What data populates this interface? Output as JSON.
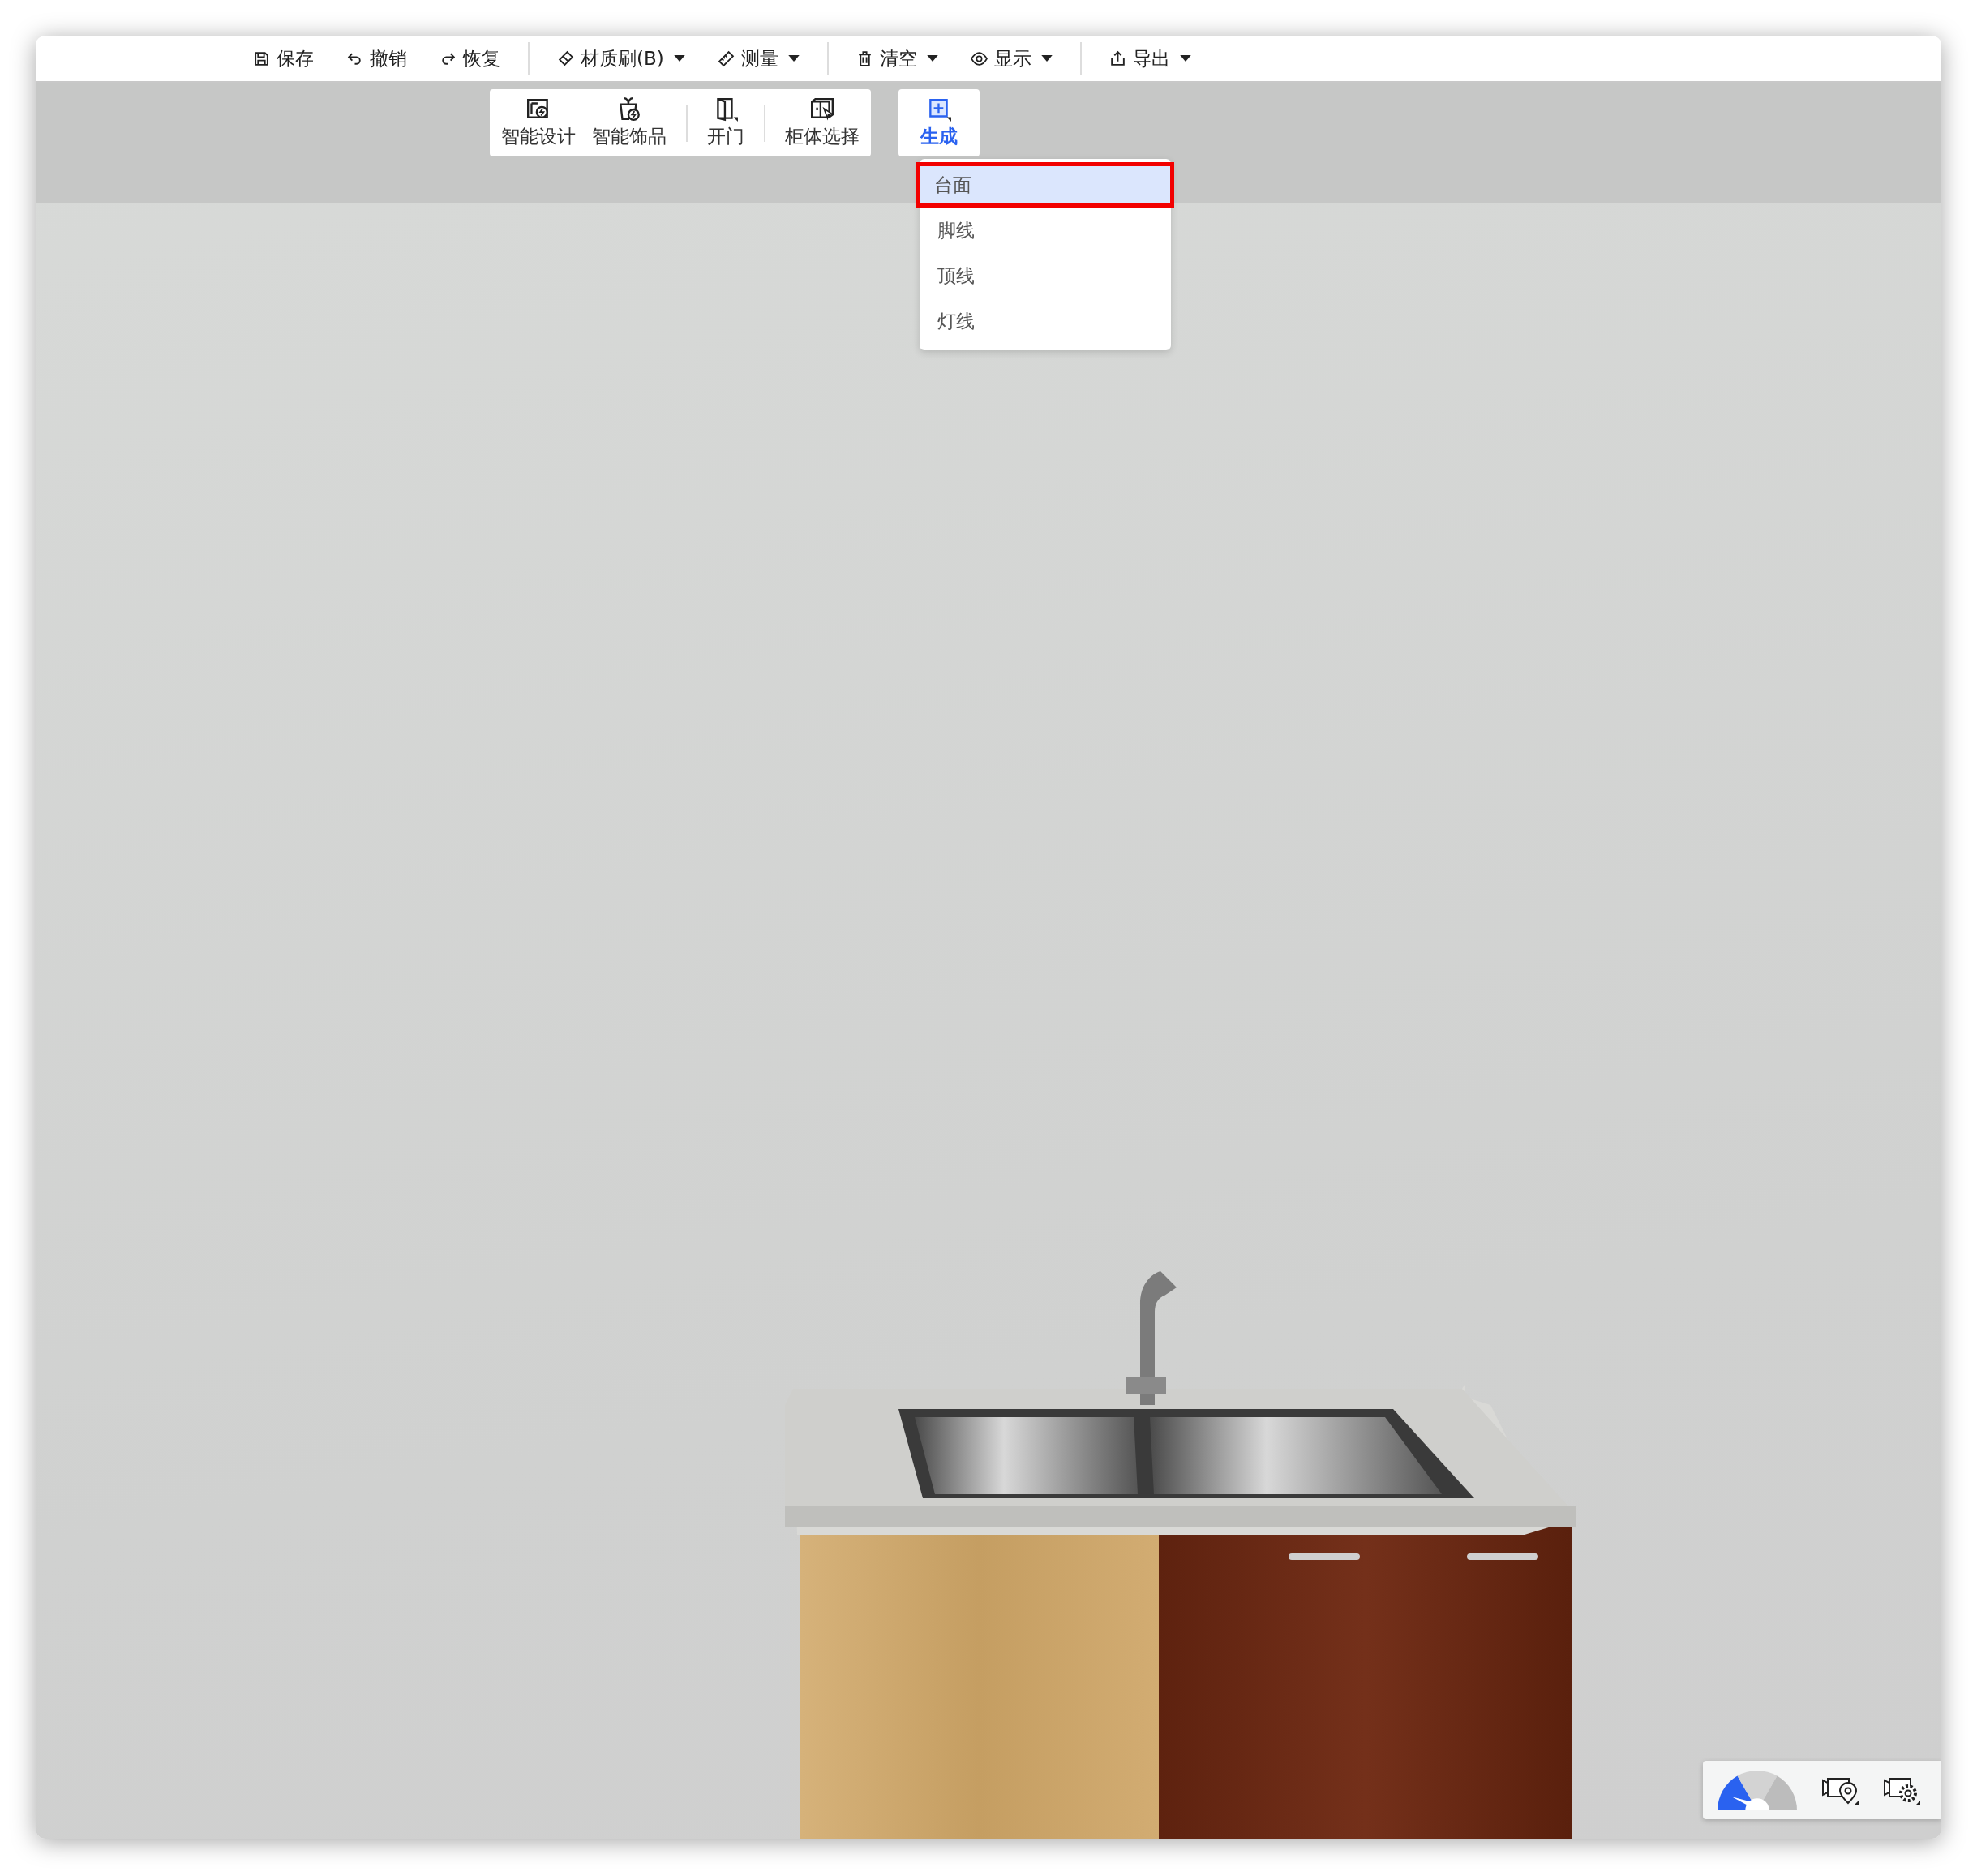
{
  "toolbar": {
    "groups": [
      [
        {
          "label": "保存",
          "dropdown": false
        },
        {
          "label": "撤销",
          "dropdown": false
        },
        {
          "label": "恢复",
          "dropdown": false
        }
      ],
      [
        {
          "label": "材质刷(B)",
          "dropdown": true
        },
        {
          "label": "测量",
          "dropdown": true
        }
      ],
      [
        {
          "label": "清空",
          "dropdown": true
        },
        {
          "label": "显示",
          "dropdown": true
        }
      ],
      [
        {
          "label": "导出",
          "dropdown": true
        }
      ]
    ]
  },
  "tool_panel": {
    "groups": [
      [
        {
          "label": "智能设计"
        },
        {
          "label": "智能饰品"
        }
      ],
      [
        {
          "label": "开门"
        }
      ],
      [
        {
          "label": "柜体选择"
        }
      ]
    ]
  },
  "generate_button": {
    "label": "生成",
    "active": true
  },
  "generate_menu": [
    {
      "label": "台面",
      "selected": true
    },
    {
      "label": "脚线",
      "selected": false
    },
    {
      "label": "顶线",
      "selected": false
    },
    {
      "label": "灯线",
      "selected": false
    }
  ]
}
